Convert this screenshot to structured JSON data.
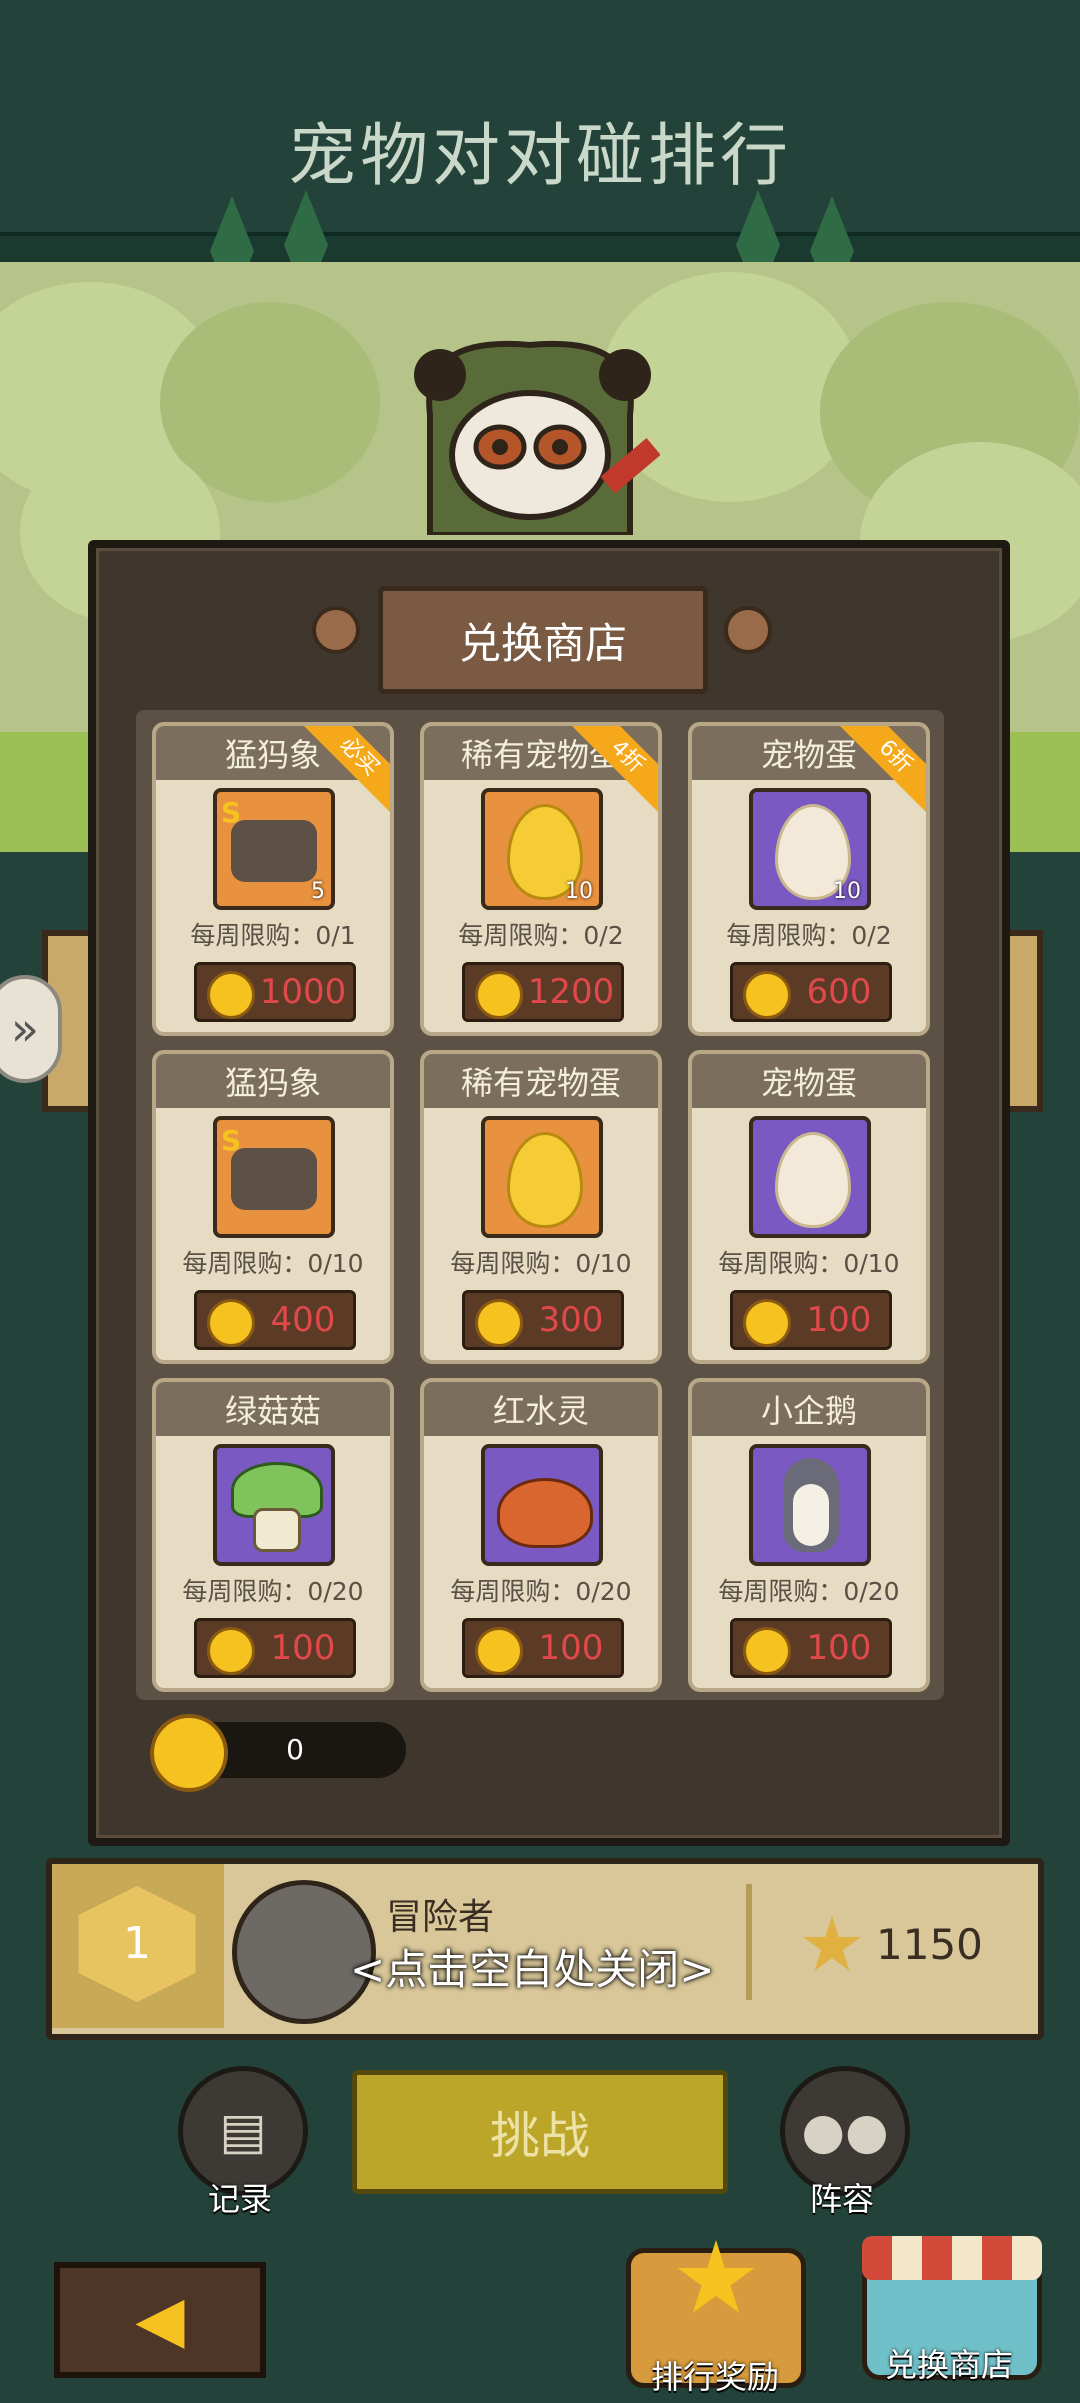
{
  "header": {
    "title": "宠物对对碰排行"
  },
  "shop": {
    "title": "兑换商店",
    "items": [
      {
        "name": "猛犸象",
        "count": "5",
        "limit": "每周限购：0/1",
        "price": "1000",
        "ribbon": "必买",
        "icon": "mammoth-icon",
        "bg": "orange"
      },
      {
        "name": "稀有宠物蛋",
        "count": "10",
        "limit": "每周限购：0/2",
        "price": "1200",
        "ribbon": "4折",
        "icon": "gold-egg-icon",
        "bg": "orange"
      },
      {
        "name": "宠物蛋",
        "count": "10",
        "limit": "每周限购：0/2",
        "price": "600",
        "ribbon": "6折",
        "icon": "pet-egg-icon",
        "bg": "purple"
      },
      {
        "name": "猛犸象",
        "count": "",
        "limit": "每周限购：0/10",
        "price": "400",
        "ribbon": "",
        "icon": "mammoth-icon",
        "bg": "orange"
      },
      {
        "name": "稀有宠物蛋",
        "count": "",
        "limit": "每周限购：0/10",
        "price": "300",
        "ribbon": "",
        "icon": "gold-egg-icon",
        "bg": "orange"
      },
      {
        "name": "宠物蛋",
        "count": "",
        "limit": "每周限购：0/10",
        "price": "100",
        "ribbon": "",
        "icon": "pet-egg-icon",
        "bg": "purple"
      },
      {
        "name": "绿菇菇",
        "count": "",
        "limit": "每周限购：0/20",
        "price": "100",
        "ribbon": "",
        "icon": "mushroom-icon",
        "bg": "purple"
      },
      {
        "name": "红水灵",
        "count": "",
        "limit": "每周限购：0/20",
        "price": "100",
        "ribbon": "",
        "icon": "slime-icon",
        "bg": "purple"
      },
      {
        "name": "小企鹅",
        "count": "",
        "limit": "每周限购：0/20",
        "price": "100",
        "ribbon": "",
        "icon": "penguin-icon",
        "bg": "purple"
      }
    ],
    "currency_amount": "0"
  },
  "rank": {
    "position": "1",
    "player_name": "冒险者",
    "close_hint": "<点击空白处关闭>",
    "score": "1150"
  },
  "actions": {
    "record_label": "记录",
    "challenge_label": "挑战",
    "lineup_label": "阵容",
    "rank_reward_label": "排行奖励",
    "exchange_shop_label": "兑换商店"
  },
  "colors": {
    "background": "#23433a",
    "price_text": "#e0484b",
    "coin": "#f5c220",
    "ribbon": "#f5a81a"
  }
}
